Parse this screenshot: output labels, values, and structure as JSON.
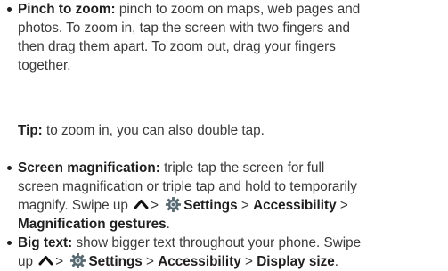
{
  "items": [
    {
      "term": "Pinch to zoom:",
      "lines": [
        "pinch to zoom on maps, web pages and",
        "photos. To zoom in, tap the screen with two fingers and",
        "then drag them apart. To zoom out, drag your fingers",
        "together."
      ]
    },
    {
      "term": "Screen magnification:",
      "lines": [
        "triple tap the screen for full",
        "screen magnification or triple tap and hold to temporarily",
        "magnify. Swipe up"
      ],
      "path": [
        "Settings",
        "Accessibility",
        "Magnification gestures"
      ]
    },
    {
      "term": "Big text:",
      "lines": [
        "show bigger text throughout your phone. Swipe",
        "up"
      ],
      "path": [
        "Settings",
        "Accessibility",
        "Display size"
      ]
    }
  ],
  "tip": {
    "label": "Tip:",
    "text": "to zoom in, you can also double tap."
  },
  "separator": ">",
  "icons": {
    "swipe_up": "chevron-up-icon",
    "settings": "settings-gear-icon"
  },
  "colors": {
    "text": "#3a3a3a",
    "bold": "#1f1f1f",
    "gear": "#5a6a72"
  }
}
